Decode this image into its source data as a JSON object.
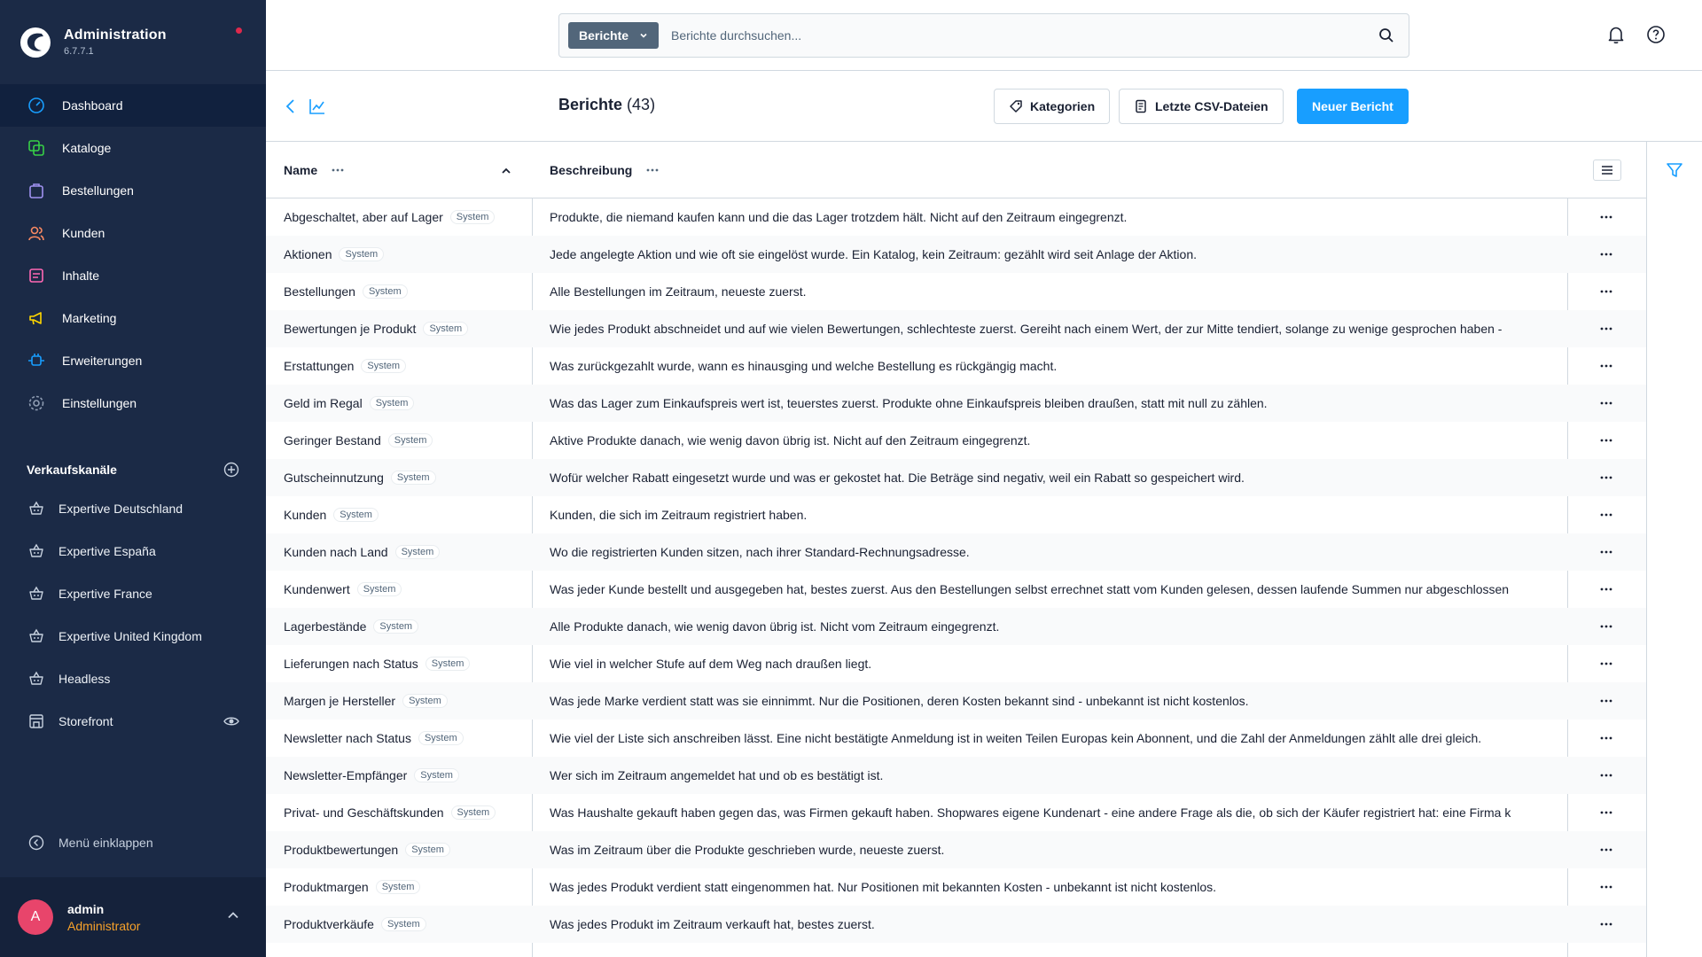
{
  "brand": {
    "title": "Administration",
    "version": "6.7.7.1"
  },
  "nav": [
    {
      "label": "Dashboard",
      "icon": "dashboard-icon",
      "active": true
    },
    {
      "label": "Kataloge",
      "icon": "catalog-icon"
    },
    {
      "label": "Bestellungen",
      "icon": "orders-icon"
    },
    {
      "label": "Kunden",
      "icon": "customers-icon"
    },
    {
      "label": "Inhalte",
      "icon": "content-icon"
    },
    {
      "label": "Marketing",
      "icon": "marketing-icon"
    },
    {
      "label": "Erweiterungen",
      "icon": "extensions-icon"
    },
    {
      "label": "Einstellungen",
      "icon": "settings-icon"
    }
  ],
  "sales_channels": {
    "title": "Verkaufskanäle",
    "items": [
      {
        "label": "Expertive Deutschland"
      },
      {
        "label": "Expertive España"
      },
      {
        "label": "Expertive France"
      },
      {
        "label": "Expertive United Kingdom"
      },
      {
        "label": "Headless"
      },
      {
        "label": "Storefront"
      }
    ]
  },
  "collapse_label": "Menü einklappen",
  "user": {
    "initial": "A",
    "name": "admin",
    "role": "Administrator"
  },
  "search": {
    "type": "Berichte",
    "placeholder": "Berichte durchsuchen..."
  },
  "page": {
    "title": "Berichte",
    "count": "(43)",
    "buttons": {
      "categories": "Kategorien",
      "csv": "Letzte CSV-Dateien",
      "new": "Neuer Bericht"
    }
  },
  "table": {
    "col_name": "Name",
    "col_desc": "Beschreibung",
    "badge": "System",
    "rows": [
      {
        "name": "Abgeschaltet, aber auf Lager",
        "desc": "Produkte, die niemand kaufen kann und die das Lager trotzdem hält. Nicht auf den Zeitraum eingegrenzt."
      },
      {
        "name": "Aktionen",
        "desc": "Jede angelegte Aktion und wie oft sie eingelöst wurde. Ein Katalog, kein Zeitraum: gezählt wird seit Anlage der Aktion."
      },
      {
        "name": "Bestellungen",
        "desc": "Alle Bestellungen im Zeitraum, neueste zuerst."
      },
      {
        "name": "Bewertungen je Produkt",
        "desc": "Wie jedes Produkt abschneidet und auf wie vielen Bewertungen, schlechteste zuerst. Gereiht nach einem Wert, der zur Mitte tendiert, solange zu wenige gesprochen haben -"
      },
      {
        "name": "Erstattungen",
        "desc": "Was zurückgezahlt wurde, wann es hinausging und welche Bestellung es rückgängig macht."
      },
      {
        "name": "Geld im Regal",
        "desc": "Was das Lager zum Einkaufspreis wert ist, teuerstes zuerst. Produkte ohne Einkaufspreis bleiben draußen, statt mit null zu zählen."
      },
      {
        "name": "Geringer Bestand",
        "desc": "Aktive Produkte danach, wie wenig davon übrig ist. Nicht auf den Zeitraum eingegrenzt."
      },
      {
        "name": "Gutscheinnutzung",
        "desc": "Wofür welcher Rabatt eingesetzt wurde und was er gekostet hat. Die Beträge sind negativ, weil ein Rabatt so gespeichert wird."
      },
      {
        "name": "Kunden",
        "desc": "Kunden, die sich im Zeitraum registriert haben."
      },
      {
        "name": "Kunden nach Land",
        "desc": "Wo die registrierten Kunden sitzen, nach ihrer Standard-Rechnungsadresse."
      },
      {
        "name": "Kundenwert",
        "desc": "Was jeder Kunde bestellt und ausgegeben hat, bestes zuerst. Aus den Bestellungen selbst errechnet statt vom Kunden gelesen, dessen laufende Summen nur abgeschlossen"
      },
      {
        "name": "Lagerbestände",
        "desc": "Alle Produkte danach, wie wenig davon übrig ist. Nicht vom Zeitraum eingegrenzt."
      },
      {
        "name": "Lieferungen nach Status",
        "desc": "Wie viel in welcher Stufe auf dem Weg nach draußen liegt."
      },
      {
        "name": "Margen je Hersteller",
        "desc": "Was jede Marke verdient statt was sie einnimmt. Nur die Positionen, deren Kosten bekannt sind - unbekannt ist nicht kostenlos."
      },
      {
        "name": "Newsletter nach Status",
        "desc": "Wie viel der Liste sich anschreiben lässt. Eine nicht bestätigte Anmeldung ist in weiten Teilen Europas kein Abonnent, und die Zahl der Anmeldungen zählt alle drei gleich."
      },
      {
        "name": "Newsletter-Empfänger",
        "desc": "Wer sich im Zeitraum angemeldet hat und ob es bestätigt ist."
      },
      {
        "name": "Privat- und Geschäftskunden",
        "desc": "Was Haushalte gekauft haben gegen das, was Firmen gekauft haben. Shopwares eigene Kundenart - eine andere Frage als die, ob sich der Käufer registriert hat: eine Firma k"
      },
      {
        "name": "Produktbewertungen",
        "desc": "Was im Zeitraum über die Produkte geschrieben wurde, neueste zuerst."
      },
      {
        "name": "Produktmargen",
        "desc": "Was jedes Produkt verdient statt eingenommen hat. Nur Positionen mit bekannten Kosten - unbekannt ist nicht kostenlos."
      },
      {
        "name": "Produktverkäufe",
        "desc": "Was jedes Produkt im Zeitraum verkauft hat, bestes zuerst."
      }
    ]
  },
  "colors": {
    "sidebar_bg": "#1b2a46",
    "primary": "#189eff",
    "avatar": "#e8456b",
    "role": "#f7a12a"
  }
}
